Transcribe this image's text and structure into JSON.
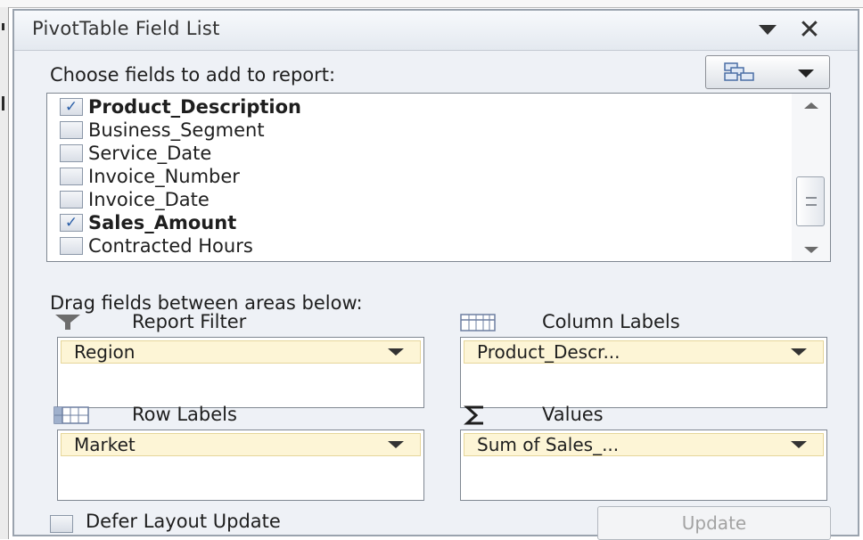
{
  "panel": {
    "title": "PivotTable Field List",
    "close_glyph": "✕",
    "dropdown_icon": "triangle-down-icon"
  },
  "fields_section": {
    "choose_label": "Choose fields to add to report:",
    "layout_button_icon": "field-list-layout-icon",
    "fields": [
      {
        "label": "Product_Description",
        "checked": true
      },
      {
        "label": "Business_Segment",
        "checked": false
      },
      {
        "label": "Service_Date",
        "checked": false
      },
      {
        "label": "Invoice_Number",
        "checked": false
      },
      {
        "label": "Invoice_Date",
        "checked": false
      },
      {
        "label": "Sales_Amount",
        "checked": true
      },
      {
        "label": "Contracted Hours",
        "checked": false
      }
    ]
  },
  "areas_section": {
    "drag_label": "Drag fields between areas below:",
    "report_filter": {
      "header": "Report Filter",
      "icon": "filter-icon",
      "item": "Region"
    },
    "column_labels": {
      "header": "Column Labels",
      "icon": "column-grid-icon",
      "item": "Product_Descr..."
    },
    "row_labels": {
      "header": "Row Labels",
      "icon": "row-grid-icon",
      "item": "Market"
    },
    "values": {
      "header": "Values",
      "icon": "sigma-icon",
      "item": "Sum of Sales_..."
    }
  },
  "footer": {
    "defer_label": "Defer Layout Update",
    "defer_checked": false,
    "update_label": "Update"
  },
  "colors": {
    "panel_bg": "#eef1f6",
    "area_item_bg": "#fdf5d6",
    "checkmark": "#2b5fa8"
  }
}
